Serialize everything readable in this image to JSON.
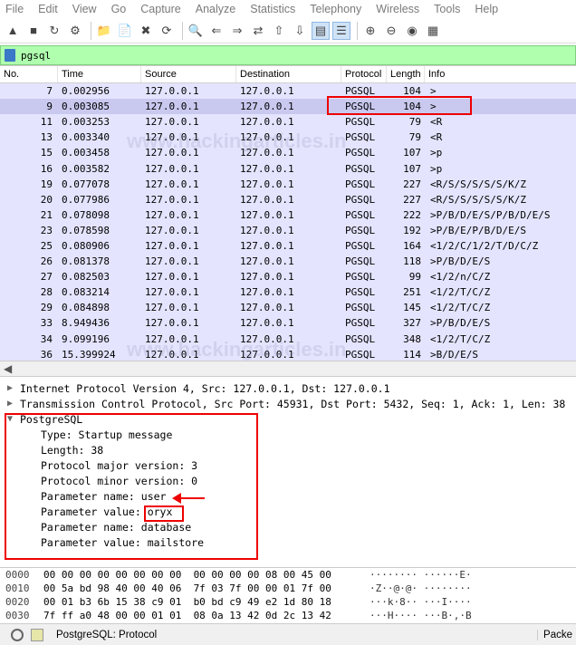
{
  "menu": [
    "File",
    "Edit",
    "View",
    "Go",
    "Capture",
    "Analyze",
    "Statistics",
    "Telephony",
    "Wireless",
    "Tools",
    "Help"
  ],
  "filter": {
    "value": "pgsql"
  },
  "columns": {
    "no": "No.",
    "time": "Time",
    "source": "Source",
    "destination": "Destination",
    "protocol": "Protocol",
    "length": "Length",
    "info": "Info"
  },
  "packets": [
    {
      "no": "7",
      "time": "0.002956",
      "src": "127.0.0.1",
      "dst": "127.0.0.1",
      "proto": "PGSQL",
      "len": "104",
      "info": ">"
    },
    {
      "no": "9",
      "time": "0.003085",
      "src": "127.0.0.1",
      "dst": "127.0.0.1",
      "proto": "PGSQL",
      "len": "104",
      "info": ">"
    },
    {
      "no": "11",
      "time": "0.003253",
      "src": "127.0.0.1",
      "dst": "127.0.0.1",
      "proto": "PGSQL",
      "len": "79",
      "info": "<R"
    },
    {
      "no": "13",
      "time": "0.003340",
      "src": "127.0.0.1",
      "dst": "127.0.0.1",
      "proto": "PGSQL",
      "len": "79",
      "info": "<R"
    },
    {
      "no": "15",
      "time": "0.003458",
      "src": "127.0.0.1",
      "dst": "127.0.0.1",
      "proto": "PGSQL",
      "len": "107",
      "info": ">p"
    },
    {
      "no": "16",
      "time": "0.003582",
      "src": "127.0.0.1",
      "dst": "127.0.0.1",
      "proto": "PGSQL",
      "len": "107",
      "info": ">p"
    },
    {
      "no": "19",
      "time": "0.077078",
      "src": "127.0.0.1",
      "dst": "127.0.0.1",
      "proto": "PGSQL",
      "len": "227",
      "info": "<R/S/S/S/S/S/K/Z"
    },
    {
      "no": "20",
      "time": "0.077986",
      "src": "127.0.0.1",
      "dst": "127.0.0.1",
      "proto": "PGSQL",
      "len": "227",
      "info": "<R/S/S/S/S/S/K/Z"
    },
    {
      "no": "21",
      "time": "0.078098",
      "src": "127.0.0.1",
      "dst": "127.0.0.1",
      "proto": "PGSQL",
      "len": "222",
      "info": ">P/B/D/E/S/P/B/D/E/S"
    },
    {
      "no": "23",
      "time": "0.078598",
      "src": "127.0.0.1",
      "dst": "127.0.0.1",
      "proto": "PGSQL",
      "len": "192",
      "info": ">P/B/E/P/B/D/E/S"
    },
    {
      "no": "25",
      "time": "0.080906",
      "src": "127.0.0.1",
      "dst": "127.0.0.1",
      "proto": "PGSQL",
      "len": "164",
      "info": "<1/2/C/1/2/T/D/C/Z"
    },
    {
      "no": "26",
      "time": "0.081378",
      "src": "127.0.0.1",
      "dst": "127.0.0.1",
      "proto": "PGSQL",
      "len": "118",
      "info": ">P/B/D/E/S"
    },
    {
      "no": "27",
      "time": "0.082503",
      "src": "127.0.0.1",
      "dst": "127.0.0.1",
      "proto": "PGSQL",
      "len": "99",
      "info": "<1/2/n/C/Z"
    },
    {
      "no": "28",
      "time": "0.083214",
      "src": "127.0.0.1",
      "dst": "127.0.0.1",
      "proto": "PGSQL",
      "len": "251",
      "info": "<1/2/T/C/Z"
    },
    {
      "no": "29",
      "time": "0.084898",
      "src": "127.0.0.1",
      "dst": "127.0.0.1",
      "proto": "PGSQL",
      "len": "145",
      "info": "<1/2/T/C/Z"
    },
    {
      "no": "33",
      "time": "8.949436",
      "src": "127.0.0.1",
      "dst": "127.0.0.1",
      "proto": "PGSQL",
      "len": "327",
      "info": ">P/B/D/E/S"
    },
    {
      "no": "34",
      "time": "9.099196",
      "src": "127.0.0.1",
      "dst": "127.0.0.1",
      "proto": "PGSQL",
      "len": "348",
      "info": "<1/2/T/C/Z"
    },
    {
      "no": "36",
      "time": "15.399924",
      "src": "127.0.0.1",
      "dst": "127.0.0.1",
      "proto": "PGSQL",
      "len": "114",
      "info": ">B/D/E/S"
    }
  ],
  "selected_row": 1,
  "details": {
    "ip": "Internet Protocol Version 4, Src: 127.0.0.1, Dst: 127.0.0.1",
    "tcp": "Transmission Control Protocol, Src Port: 45931, Dst Port: 5432, Seq: 1, Ack: 1, Len: 38",
    "pg": "PostgreSQL",
    "fields": [
      "Type: Startup message",
      "Length: 38",
      "Protocol major version: 3",
      "Protocol minor version: 0",
      "Parameter name: user",
      "Parameter value: oryx",
      "Parameter name: database",
      "Parameter value: mailstore"
    ]
  },
  "hex": [
    {
      "off": "0000",
      "bytes": "00 00 00 00 00 00 00 00  00 00 00 00 08 00 45 00",
      "ascii": "········ ······E·"
    },
    {
      "off": "0010",
      "bytes": "00 5a bd 98 40 00 40 06  7f 03 7f 00 00 01 7f 00",
      "ascii": "·Z··@·@· ········"
    },
    {
      "off": "0020",
      "bytes": "00 01 b3 6b 15 38 c9 01  b0 bd c9 49 e2 1d 80 18",
      "ascii": "···k·8·· ···I····"
    },
    {
      "off": "0030",
      "bytes": "7f ff a0 48 00 00 01 01  08 0a 13 42 0d 2c 13 42",
      "ascii": "···H···· ···B·,·B"
    }
  ],
  "status": {
    "left": "PostgreSQL: Protocol",
    "right": "Packe"
  },
  "watermark": "www.hackingarticles.in",
  "colors": {
    "row_bg": "#e4e4ff",
    "selected_bg": "#c9c9f0",
    "filter_bg": "#afffaf",
    "highlight": "#ee0000"
  }
}
